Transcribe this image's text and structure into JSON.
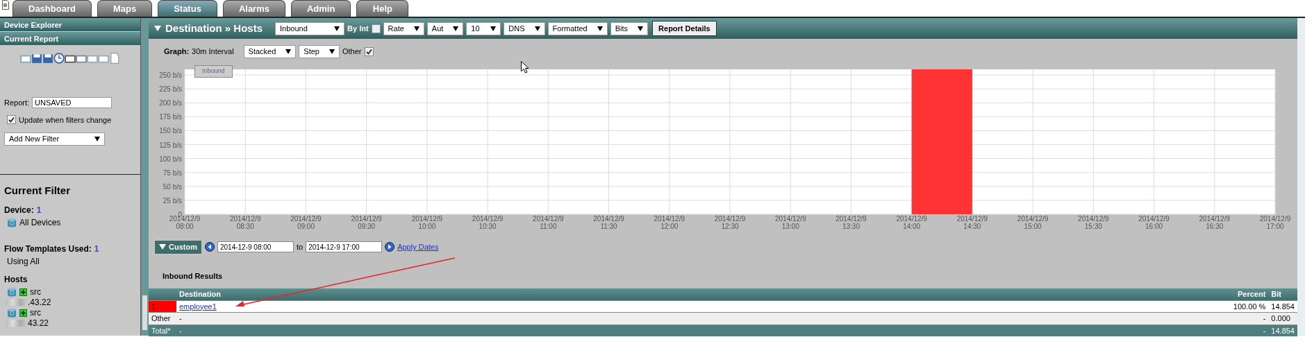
{
  "tabs": [
    {
      "label": "Dashboard",
      "selected": false
    },
    {
      "label": "Maps",
      "selected": false
    },
    {
      "label": "Status",
      "selected": true
    },
    {
      "label": "Alarms",
      "selected": false
    },
    {
      "label": "Admin",
      "selected": false
    },
    {
      "label": "Help",
      "selected": false
    }
  ],
  "sidebar": {
    "sections": [
      {
        "title": "Device Explorer"
      },
      {
        "title": "Current Report"
      }
    ],
    "report": {
      "label": "Report:",
      "value": "UNSAVED"
    },
    "update_checkbox": {
      "label": "Update when filters change",
      "checked": true
    },
    "filter_select": {
      "value": "Add New Filter"
    },
    "current_filter": {
      "title": "Current Filter",
      "device": {
        "label": "Device:",
        "count": "1",
        "item": "All Devices"
      },
      "templates": {
        "label": "Flow Templates Used:",
        "count": "1",
        "item": "Using All"
      },
      "hosts": {
        "label": "Hosts",
        "items": [
          {
            "direction": "src",
            "address": ".43.22"
          },
          {
            "direction": "src",
            "address": "43.22"
          }
        ]
      }
    }
  },
  "report": {
    "title": "Destination » Hosts",
    "controls": [
      {
        "kind": "select",
        "value": "Inbound"
      },
      {
        "kind": "checkbox",
        "label": "By Int",
        "checked": false
      },
      {
        "kind": "select",
        "value": "Rate"
      },
      {
        "kind": "select",
        "value": "Aut"
      },
      {
        "kind": "select",
        "value": "10"
      },
      {
        "kind": "select",
        "value": "DNS"
      },
      {
        "kind": "select",
        "value": "Formatted"
      },
      {
        "kind": "select",
        "value": "Bits"
      },
      {
        "kind": "button",
        "label": "Report Details"
      }
    ],
    "graph_options": {
      "label": "Graph:",
      "interval": "30m Interval",
      "controls": [
        {
          "kind": "select",
          "value": "Stacked"
        },
        {
          "kind": "select",
          "value": "Step"
        },
        {
          "kind": "checkbox",
          "label": "Other",
          "checked": true
        }
      ]
    },
    "chart_data": {
      "type": "bar",
      "grid": true,
      "categories": [
        "2014/12/9 08:00",
        "2014/12/9 08:30",
        "2014/12/9 09:00",
        "2014/12/9 09:30",
        "2014/12/9 10:00",
        "2014/12/9 10:30",
        "2014/12/9 11:00",
        "2014/12/9 11:30",
        "2014/12/9 12:00",
        "2014/12/9 12:30",
        "2014/12/9 13:00",
        "2014/12/9 13:30",
        "2014/12/9 14:00",
        "2014/12/9 14:30",
        "2014/12/9 15:00",
        "2014/12/9 15:30",
        "2014/12/9 16:00",
        "2014/12/9 16:30",
        "2014/12/9 17:00"
      ],
      "series": [
        {
          "name": "Inbound",
          "color": "#ff3333",
          "values": [
            0,
            0,
            0,
            0,
            0,
            0,
            0,
            0,
            0,
            0,
            0,
            0,
            260,
            0,
            0,
            0,
            0,
            0,
            0
          ]
        }
      ],
      "ylim": [
        0,
        260
      ],
      "yticks": [
        {
          "value": 0,
          "label": "0"
        },
        {
          "value": 25,
          "label": "25 b/s"
        },
        {
          "value": 50,
          "label": "50 b/s"
        },
        {
          "value": 75,
          "label": "75 b/s"
        },
        {
          "value": 100,
          "label": "100 b/s"
        },
        {
          "value": 125,
          "label": "125 b/s"
        },
        {
          "value": 150,
          "label": "150 b/s"
        },
        {
          "value": 175,
          "label": "175 b/s"
        },
        {
          "value": 200,
          "label": "200 b/s"
        },
        {
          "value": 225,
          "label": "225 b/s"
        },
        {
          "value": 250,
          "label": "250 b/s"
        }
      ]
    },
    "date_range": {
      "mode": "Custom",
      "from": "2014-12-9 08:00",
      "to_label": "to",
      "to": "2014-12-9 17:00",
      "apply": "Apply Dates"
    },
    "results": {
      "title": "Inbound Results",
      "columns": [
        "Destination",
        "Percent",
        "Bit"
      ],
      "rows": [
        {
          "kind": "item",
          "rank": "1",
          "color": "#ff0000",
          "destination": "employee1",
          "percent": "100.00 %",
          "bits": "14.854"
        },
        {
          "kind": "other",
          "rank": "Other",
          "destination": "-",
          "percent": "-",
          "bits": "0.000"
        },
        {
          "kind": "total",
          "rank": "Total*",
          "destination": "-",
          "percent": "-",
          "bits": "14.854"
        }
      ]
    }
  }
}
